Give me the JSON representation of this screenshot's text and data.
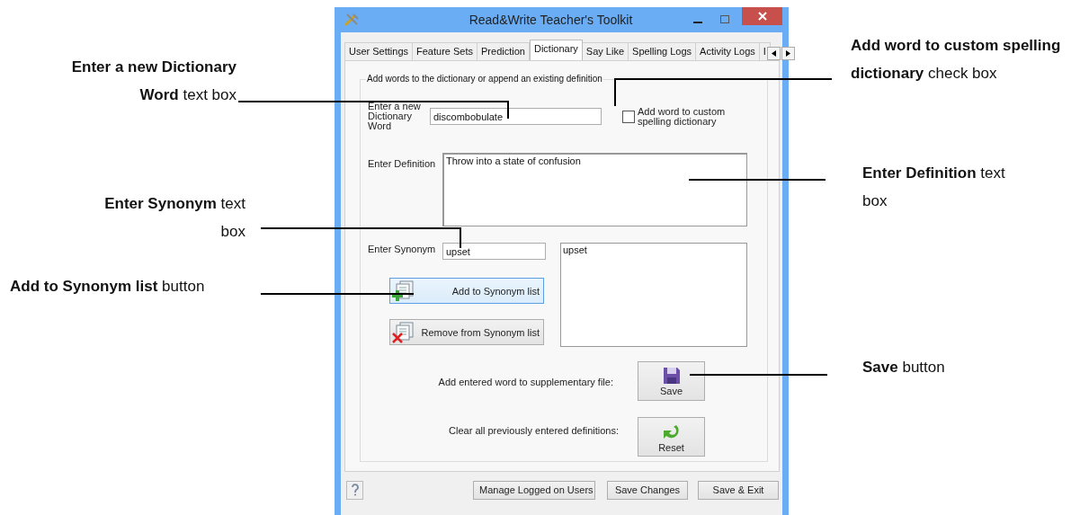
{
  "window": {
    "title": "Read&Write Teacher's Toolkit"
  },
  "tabs": [
    {
      "label": "User Settings",
      "selected": false
    },
    {
      "label": "Feature Sets",
      "selected": false
    },
    {
      "label": "Prediction",
      "selected": false
    },
    {
      "label": "Dictionary",
      "selected": true
    },
    {
      "label": "Say Like",
      "selected": false
    },
    {
      "label": "Spelling Logs",
      "selected": false
    },
    {
      "label": "Activity Logs",
      "selected": false
    },
    {
      "label": "I",
      "selected": false
    }
  ],
  "group": {
    "caption": "Add words to the dictionary or append an existing definition"
  },
  "dictionary_word": {
    "label": "Enter a new Dictionary Word",
    "value": "discombobulate"
  },
  "custom_dictionary": {
    "label": "Add word to custom spelling dictionary",
    "checked": false
  },
  "definition": {
    "label": "Enter Definition",
    "value": "Throw into a state of confusion"
  },
  "synonym": {
    "label": "Enter Synonym",
    "value": "upset"
  },
  "synonym_list": [
    "upset"
  ],
  "synonym_buttons": [
    {
      "label": "Add to Synonym list",
      "kind": "add",
      "focused": true
    },
    {
      "label": "Remove from Synonym list",
      "kind": "remove",
      "focused": false
    }
  ],
  "actions": [
    {
      "description": "Add entered word to supplementary file:",
      "label": "Save",
      "kind": "save"
    },
    {
      "description": "Clear all previously entered definitions:",
      "label": "Reset",
      "kind": "reset"
    }
  ],
  "footer_buttons": [
    "Manage Logged on Users",
    "Save Changes",
    "Save & Exit"
  ],
  "callouts": [
    {
      "text": "**Enter a new Dictionary Word** text box"
    },
    {
      "text": "**Add word to custom spelling dictionary** check box"
    },
    {
      "text": "**Enter Definition** text box"
    },
    {
      "text": "**Enter Synonym** text box"
    },
    {
      "text": "**Add to Synonym list** button"
    },
    {
      "text": "**Save** button"
    }
  ]
}
